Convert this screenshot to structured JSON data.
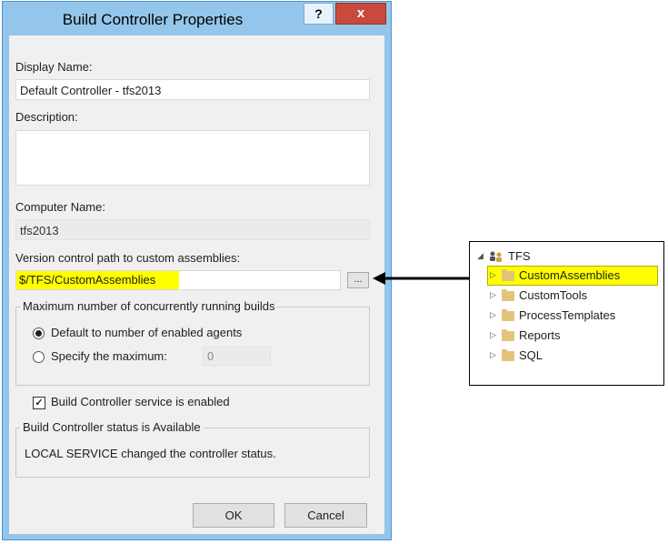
{
  "dialog": {
    "title": "Build Controller Properties",
    "help_label": "?",
    "close_label": "x",
    "display_name_label": "Display Name:",
    "display_name_value": "Default Controller - tfs2013",
    "description_label": "Description:",
    "description_value": "",
    "computer_name_label": "Computer Name:",
    "computer_name_value": "tfs2013",
    "custom_path_label": "Version control path to custom assemblies:",
    "custom_path_value": "$/TFS/CustomAssemblies",
    "browse_label": "...",
    "max_builds_group": {
      "title": "Maximum number of concurrently running builds",
      "option_default": "Default to number of enabled agents",
      "option_specify": "Specify the maximum:",
      "max_value": "0",
      "selected": "default"
    },
    "service_enabled_label": "Build Controller service is enabled",
    "service_enabled_checked": true,
    "status_group": {
      "title": "Build Controller status is Available",
      "message": "LOCAL SERVICE changed the controller status."
    },
    "ok_label": "OK",
    "cancel_label": "Cancel"
  },
  "tree": {
    "root": "TFS",
    "items": [
      "CustomAssemblies",
      "CustomTools",
      "ProcessTemplates",
      "Reports",
      "SQL"
    ],
    "selected": "CustomAssemblies"
  },
  "colors": {
    "highlight": "#ffff00",
    "title_bar": "#93c6ea",
    "close_button": "#c74a3d"
  }
}
